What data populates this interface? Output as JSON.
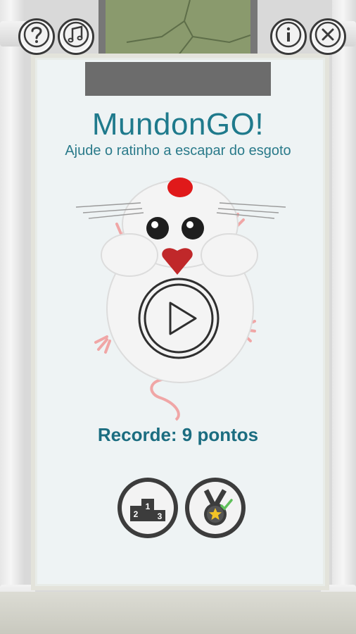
{
  "game": {
    "title": "MundonGO!",
    "subtitle": "Ajude o ratinho a escapar do esgoto",
    "record_text": "Recorde: 9 pontos"
  },
  "top_buttons": {
    "help_icon": "question-mark-icon",
    "music_icon": "music-note-icon",
    "info_icon": "info-icon",
    "close_icon": "close-icon"
  },
  "bottom_buttons": {
    "ranking_icon": "podium-icon",
    "achievements_icon": "medal-icon",
    "podium_labels": [
      "2",
      "1",
      "3"
    ]
  },
  "colors": {
    "title": "#1f7a8c",
    "record": "#1b6d80",
    "button_dark": "#3a3a3a",
    "heart": "#c0282a",
    "rat_hat": "#e0191a"
  }
}
